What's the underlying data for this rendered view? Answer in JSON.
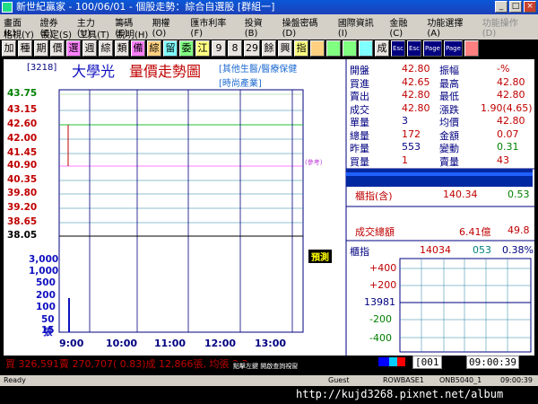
{
  "window": {
    "title": "新世紀贏家 - 100/06/01 - 個股走勢：綜合自選股 [群組一]"
  },
  "menu": {
    "row1": [
      "畫面(L)",
      "證券(E)",
      "主力(U)",
      "籌碼(E)",
      "期權(O)",
      "匯市利率(F)",
      "投資(B)",
      "操盤密碼(D)",
      "國際資訊(I)",
      "金融(C)",
      "功能選擇(A)",
      "功能操作(D)"
    ],
    "row2": [
      "格視(Y)",
      "設定(S)",
      "工具(T)",
      "說明(H)"
    ]
  },
  "toolbar": {
    "buttons": [
      "加",
      "種",
      "期",
      "價",
      "選",
      "週",
      "綜",
      "類",
      "備",
      "綜",
      "留",
      "委",
      "江",
      "9",
      "8",
      "29",
      "餘",
      "興",
      "指",
      "",
      "",
      "",
      "",
      "成",
      "Esc",
      "Esc",
      "Page",
      "Page",
      ""
    ]
  },
  "header": {
    "code": "[3218]",
    "name": "大學光",
    "chart_title": "量價走勢圖",
    "tag1": "[其他生醫/醫療保健",
    "tag2": "[時尚產業]"
  },
  "price_axis": {
    "labels": [
      "43.75",
      "43.15",
      "42.60",
      "42.00",
      "41.45",
      "40.90",
      "40.35",
      "39.80",
      "39.20",
      "38.65",
      "38.05"
    ],
    "colors": [
      "#008000",
      "#c00000",
      "#c00000",
      "#c00000",
      "#c00000",
      "#c00000",
      "#c00000",
      "#c00000",
      "#c00000",
      "#c00000",
      "#000000"
    ],
    "reference_note": "(參考)"
  },
  "volume_axis": {
    "labels": [
      "3,000",
      "1,000",
      "500",
      "200",
      "100",
      "50",
      "15",
      "張"
    ]
  },
  "time_axis": {
    "labels": [
      "9:00",
      "10:00",
      "11:00",
      "12:00",
      "13:00"
    ]
  },
  "trial_badge": "預測",
  "quote": {
    "rows": [
      {
        "k1": "開盤",
        "v1": "42.80",
        "k2": "振幅",
        "v2": "-%"
      },
      {
        "k1": "買進",
        "v1": "42.65",
        "k2": "最高",
        "v2": "42.80"
      },
      {
        "k1": "賣出",
        "v1": "42.80",
        "k2": "最低",
        "v2": "42.80"
      },
      {
        "k1": "成交",
        "v1": "42.80",
        "k2": "漲跌",
        "v2": "1.90(4.65)"
      },
      {
        "k1": "單量",
        "v1": "3",
        "k2": "均價",
        "v2": "42.80"
      },
      {
        "k1": "總量",
        "v1": "172",
        "k2": "金額",
        "v2": "0.07"
      },
      {
        "k1": "昨量",
        "v1": "553",
        "k2": "變動",
        "v2": "0.31"
      },
      {
        "k1": "買量",
        "v1": "1",
        "k2": "賣量",
        "v2": "43"
      }
    ]
  },
  "index_panel": {
    "label": "櫃指(含)",
    "value": "140.34",
    "change": "0.53",
    "turnover_label": "成交總額",
    "turnover": "6.41億",
    "turnover_pct": "49.8"
  },
  "otc_chart": {
    "label": "櫃指",
    "value": "14034",
    "chg": "053",
    "pct": "0.38%",
    "axis": [
      "+400",
      "+200",
      "13981",
      "-200",
      "-400"
    ]
  },
  "ticker": {
    "text": "買 326,591賣 270,707( 0.83)成 12,866張, 均張 2.3",
    "hint": "點擊左鍵 開啟查詢視窗"
  },
  "clock": {
    "code": "[001",
    "time": "09:00:39"
  },
  "statusbar": {
    "left": "Ready",
    "guest": "Guest",
    "server": "ROWBASE1",
    "conn": "ONB5040_1",
    "time": "09:00:39"
  },
  "watermark": "http://kujd3268.pixnet.net/album",
  "chart_data": {
    "type": "line",
    "title": "量價走勢圖",
    "price_levels": [
      43.75,
      43.15,
      42.6,
      42.0,
      41.45,
      40.9,
      40.35,
      39.8,
      39.2,
      38.65,
      38.05
    ],
    "reference_price": 40.9,
    "series": [
      {
        "name": "price",
        "x": [
          "9:00"
        ],
        "values": [
          42.8
        ]
      },
      {
        "name": "volume",
        "x": [
          "9:00"
        ],
        "values": [
          172
        ]
      }
    ]
  }
}
